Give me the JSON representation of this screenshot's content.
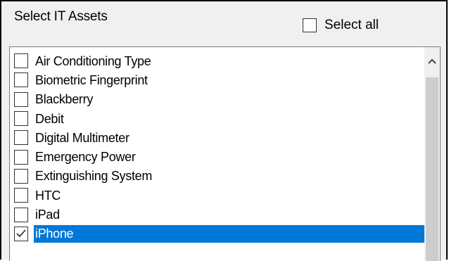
{
  "panel": {
    "title": "Select IT Assets",
    "select_all_label": "Select all",
    "select_all_checked": false
  },
  "list": {
    "items": [
      {
        "label": "Air Conditioning Type",
        "checked": false,
        "selected": false
      },
      {
        "label": "Biometric Fingerprint",
        "checked": false,
        "selected": false
      },
      {
        "label": "Blackberry",
        "checked": false,
        "selected": false
      },
      {
        "label": "Debit",
        "checked": false,
        "selected": false
      },
      {
        "label": "Digital Multimeter",
        "checked": false,
        "selected": false
      },
      {
        "label": "Emergency Power",
        "checked": false,
        "selected": false
      },
      {
        "label": "Extinguishing System",
        "checked": false,
        "selected": false
      },
      {
        "label": "HTC",
        "checked": false,
        "selected": false
      },
      {
        "label": "iPad",
        "checked": false,
        "selected": false
      },
      {
        "label": "iPhone",
        "checked": true,
        "selected": true
      }
    ]
  },
  "colors": {
    "selection_bg": "#0078d7",
    "selection_text": "#ffffff",
    "scroll_thumb": "#cdcdcd"
  },
  "icons": {
    "scroll_up": "chevron-up-icon",
    "checkmark": "checkmark-icon"
  }
}
